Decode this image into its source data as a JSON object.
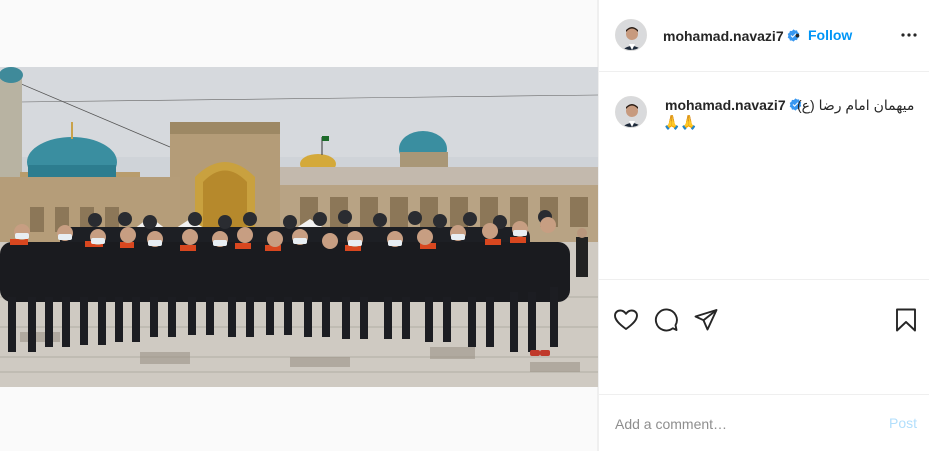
{
  "post": {
    "username": "mohamad.navazi7",
    "verified": true,
    "follow_label": "Follow",
    "separator": "•",
    "more_icon": "more-horizontal-icon"
  },
  "caption": {
    "username": "mohamad.navazi7",
    "text": "میهمان امام رضا (ع)",
    "emoji": "🙏🙏"
  },
  "actions": {
    "icons": [
      "heart-icon",
      "comment-icon",
      "share-icon",
      "bookmark-icon"
    ]
  },
  "comment": {
    "placeholder": "Add a comment…",
    "post_label": "Post"
  },
  "colors": {
    "link_blue": "#0095f6",
    "post_disabled": "#b2dffc",
    "text": "#262626",
    "muted": "#8e8e8e",
    "border": "#efefef"
  }
}
